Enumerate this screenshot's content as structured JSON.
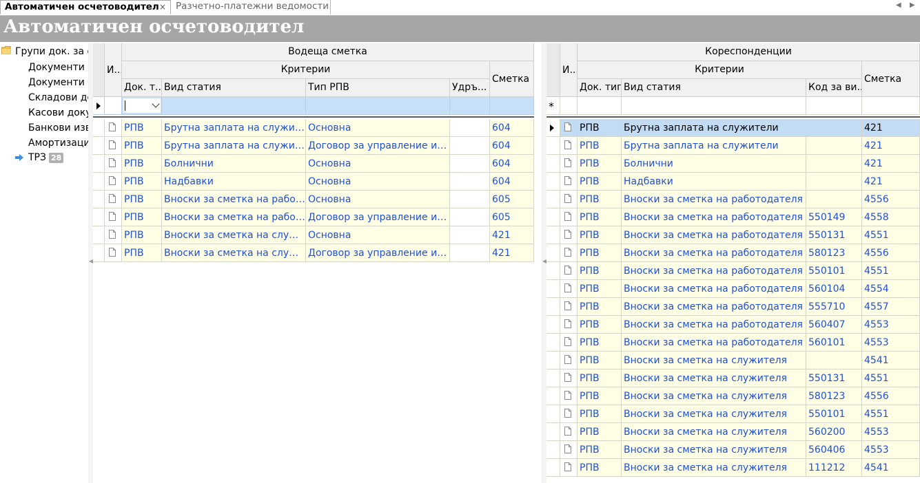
{
  "tabs": [
    {
      "label": "Автоматичен осчетоводител",
      "close": "×"
    },
    {
      "label": "Разчетно-платежни ведомости"
    }
  ],
  "tab_nav": {
    "left": "◀",
    "right": "▶"
  },
  "title": "Автоматичен осчетоводител",
  "tree": {
    "root": "Групи док. за осчетоводяване",
    "items": [
      "Документи з",
      "Документи з",
      "Складови до",
      "Касови доку",
      "Банкови изв",
      "Амортизаци"
    ],
    "selected": {
      "label": "ТРЗ",
      "badge": "28"
    }
  },
  "left_grid": {
    "group_header": "Водеща сметка",
    "criteria_header": "Критерии",
    "indicator_header": "И...",
    "columns": [
      "Док. т...",
      "Вид статия",
      "Тип РПВ",
      "Удръ...",
      "Сметка"
    ],
    "rows": [
      [
        "РПВ",
        "Брутна заплата на служители",
        "Основна",
        "",
        "604"
      ],
      [
        "РПВ",
        "Брутна заплата на служители",
        "Договор за управление и контрол",
        "",
        "604"
      ],
      [
        "РПВ",
        "Болнични",
        "Основна",
        "",
        "604"
      ],
      [
        "РПВ",
        "Надбавки",
        "Основна",
        "",
        "604"
      ],
      [
        "РПВ",
        "Вноски за сметка на работодателя",
        "Основна",
        "",
        "605"
      ],
      [
        "РПВ",
        "Вноски за сметка на работодателя",
        "Договор за управление и контрол",
        "",
        "605"
      ],
      [
        "РПВ",
        "Вноски за сметка на служителя",
        "Основна",
        "",
        "421"
      ],
      [
        "РПВ",
        "Вноски за сметка на служителя",
        "Договор за управление и контрол",
        "",
        "421"
      ]
    ]
  },
  "right_grid": {
    "group_header": "Кореспонденции",
    "criteria_header": "Критерии",
    "indicator_header": "И...",
    "columns": [
      "Док. тип",
      "Вид статия",
      "Код за ви...",
      "Сметка"
    ],
    "new_row_marker": "*",
    "rows": [
      [
        "РПВ",
        "Брутна заплата на служители",
        "",
        "421"
      ],
      [
        "РПВ",
        "Брутна заплата на служители",
        "",
        "421"
      ],
      [
        "РПВ",
        "Болнични",
        "",
        "421"
      ],
      [
        "РПВ",
        "Надбавки",
        "",
        "421"
      ],
      [
        "РПВ",
        "Вноски за сметка на работодателя",
        "",
        "4556"
      ],
      [
        "РПВ",
        "Вноски за сметка на работодателя",
        "550149",
        "4558"
      ],
      [
        "РПВ",
        "Вноски за сметка на работодателя",
        "550131",
        "4551"
      ],
      [
        "РПВ",
        "Вноски за сметка на работодателя",
        "580123",
        "4556"
      ],
      [
        "РПВ",
        "Вноски за сметка на работодателя",
        "550101",
        "4551"
      ],
      [
        "РПВ",
        "Вноски за сметка на работодателя",
        "560104",
        "4554"
      ],
      [
        "РПВ",
        "Вноски за сметка на работодателя",
        "555710",
        "4557"
      ],
      [
        "РПВ",
        "Вноски за сметка на работодателя",
        "560407",
        "4553"
      ],
      [
        "РПВ",
        "Вноски за сметка на работодателя",
        "560101",
        "4553"
      ],
      [
        "РПВ",
        "Вноски за сметка на служителя",
        "",
        "4541"
      ],
      [
        "РПВ",
        "Вноски за сметка на служителя",
        "550131",
        "4551"
      ],
      [
        "РПВ",
        "Вноски за сметка на служителя",
        "580123",
        "4556"
      ],
      [
        "РПВ",
        "Вноски за сметка на служителя",
        "550101",
        "4551"
      ],
      [
        "РПВ",
        "Вноски за сметка на служителя",
        "560200",
        "4553"
      ],
      [
        "РПВ",
        "Вноски за сметка на служителя",
        "560406",
        "4553"
      ],
      [
        "РПВ",
        "Вноски за сметка на служителя",
        "111212",
        "4541"
      ]
    ]
  }
}
